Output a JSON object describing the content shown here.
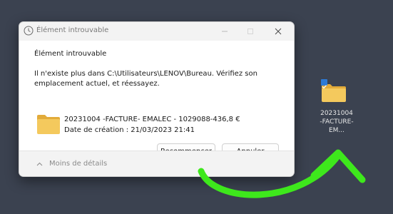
{
  "dialog": {
    "title": "Élément introuvable",
    "heading": "Élément introuvable",
    "message": "Il n'existe plus dans C:\\Utilisateurs\\LENOV\\Bureau. Vérifiez son emplacement actuel, et réessayez.",
    "file": {
      "name": "20231004 -FACTURE- EMALEC - 1029088-436,8 €",
      "date": "Date de création : 21/03/2023 21:41",
      "icon": "folder-icon"
    },
    "buttons": {
      "retry": "Recommencer",
      "cancel": "Annuler"
    },
    "less_details": "Moins de détails"
  },
  "desktop_icon": {
    "label_line1": "20231004",
    "label_line2": "-FACTURE- EM...",
    "icon": "folder-icon"
  },
  "colors": {
    "desktop_background": "#3b4250",
    "folder": "#f2c55c",
    "annotation_arrow": "#3ee81c",
    "selection_check": "#2d7ad6"
  }
}
